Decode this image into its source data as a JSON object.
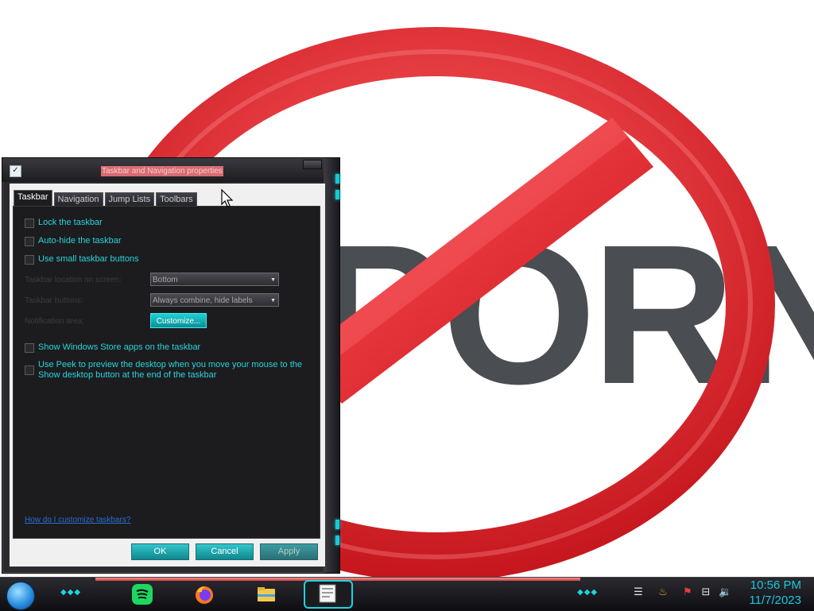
{
  "dialog": {
    "title": "Taskbar and Navigation properties",
    "tabs": [
      {
        "label": "Taskbar",
        "active": true
      },
      {
        "label": "Navigation",
        "active": false
      },
      {
        "label": "Jump Lists",
        "active": false
      },
      {
        "label": "Toolbars",
        "active": false
      }
    ],
    "checkboxes": {
      "lock": {
        "label": "Lock the taskbar",
        "checked": false
      },
      "autohide": {
        "label": "Auto-hide the taskbar",
        "checked": false
      },
      "small_buttons": {
        "label": "Use small taskbar buttons",
        "checked": false
      },
      "store_apps": {
        "label": "Show Windows Store apps on the taskbar",
        "checked": false
      },
      "peek_line1": "Use Peek to preview the desktop when you move your mouse to the",
      "peek_line2": "Show desktop button at the end of the taskbar",
      "peek_checked": false
    },
    "fields": {
      "location_label": "Taskbar location on screen:",
      "location_value": "Bottom",
      "buttons_label": "Taskbar buttons:",
      "buttons_value": "Always combine, hide labels",
      "notification_label": "Notification area:",
      "customize_label": "Customize..."
    },
    "help_link": "How do I customize taskbars?",
    "buttons": {
      "ok": "OK",
      "cancel": "Cancel",
      "apply": "Apply"
    }
  },
  "wallpaper": {
    "text": "PORN",
    "sign_color": "#e0262c",
    "text_color": "#4a4d52"
  },
  "taskbar": {
    "apps": [
      "spotify-icon",
      "firefox-icon",
      "file-explorer-icon",
      "task-view-icon"
    ],
    "tray_icons": [
      "flag-icon",
      "network-icon",
      "volume-icon",
      "java-icon"
    ],
    "clock": {
      "time": "10:56 PM",
      "date": "11/7/2023"
    },
    "accent": "#19c7e0"
  }
}
